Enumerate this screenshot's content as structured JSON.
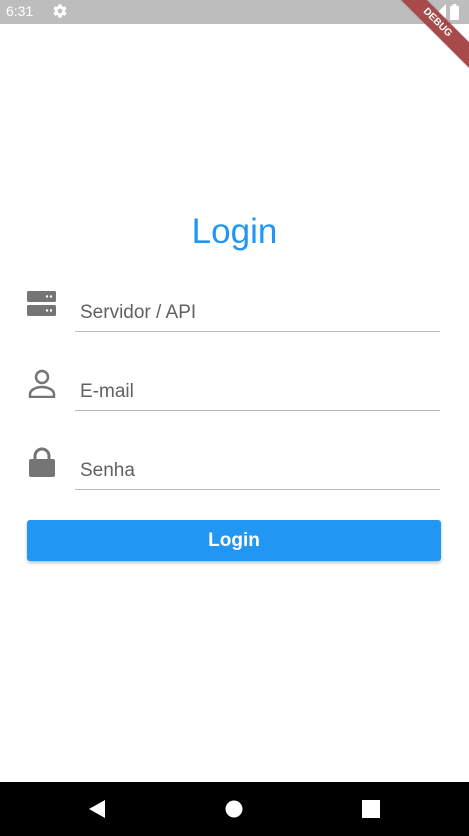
{
  "status_bar": {
    "time": "6:31",
    "icons": [
      "settings-gear-icon",
      "wifi-icon",
      "signal-icon",
      "battery-icon"
    ]
  },
  "debug_banner": "DEBUG",
  "login_form": {
    "title": "Login",
    "fields": [
      {
        "icon": "server-icon",
        "placeholder": "Servidor / API",
        "value": ""
      },
      {
        "icon": "person-icon",
        "placeholder": "E-mail",
        "value": ""
      },
      {
        "icon": "lock-icon",
        "placeholder": "Senha",
        "value": ""
      }
    ],
    "button_label": "Login"
  },
  "nav_bar": {
    "buttons": [
      "back-icon",
      "home-icon",
      "recents-icon"
    ]
  },
  "colors": {
    "accent": "#2196f3",
    "icon_gray": "#757575",
    "status_bar": "#bdbdbd",
    "nav_bar": "#000000",
    "debug_ribbon": "#a84a4a"
  }
}
